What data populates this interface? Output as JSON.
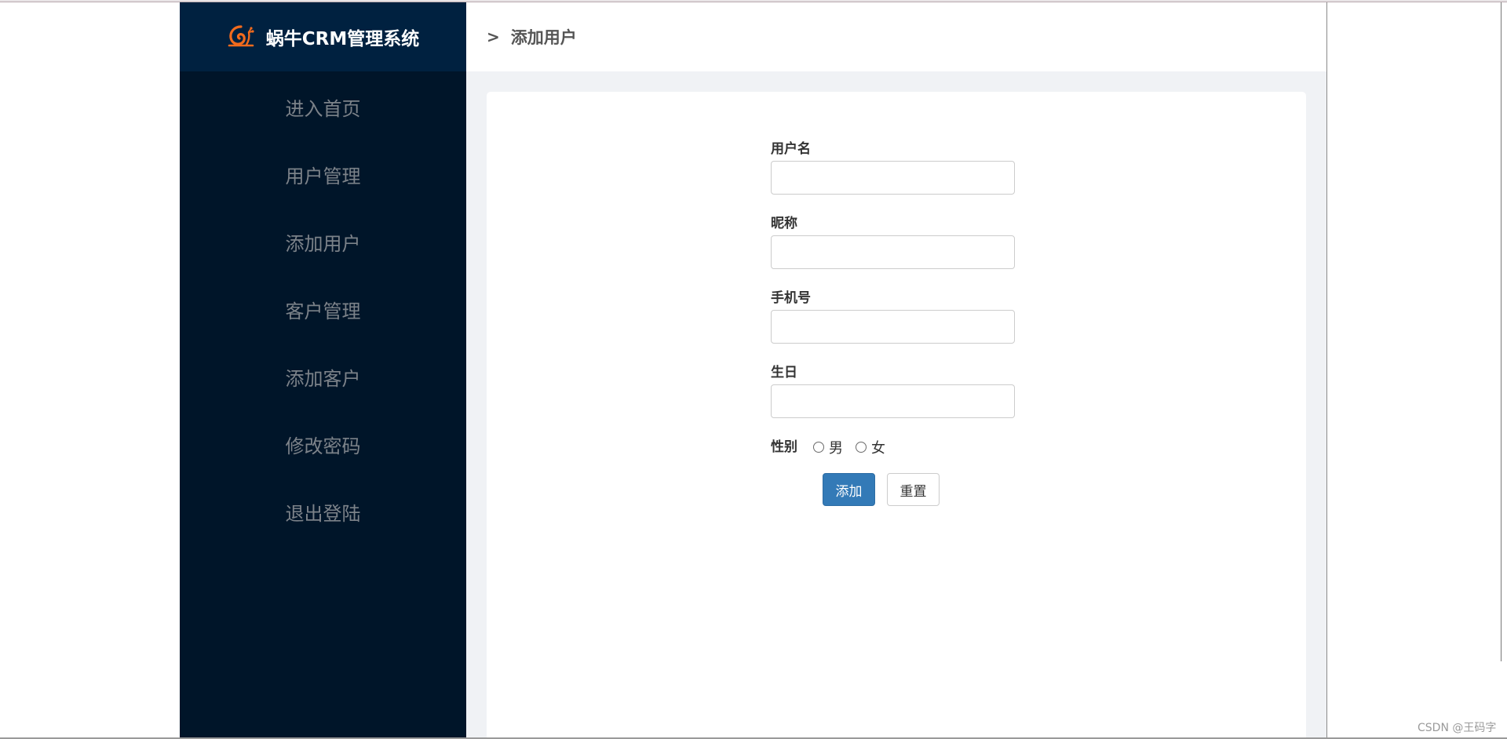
{
  "sidebar": {
    "logo_title": "蜗牛CRM管理系统",
    "logo_icon": "snail-icon",
    "items": [
      {
        "label": "进入首页"
      },
      {
        "label": "用户管理"
      },
      {
        "label": "添加用户"
      },
      {
        "label": "客户管理"
      },
      {
        "label": "添加客户"
      },
      {
        "label": "修改密码"
      },
      {
        "label": "退出登陆"
      }
    ]
  },
  "header": {
    "separator": ">",
    "title": "添加用户"
  },
  "form": {
    "username_label": "用户名",
    "username_value": "",
    "nickname_label": "昵称",
    "nickname_value": "",
    "phone_label": "手机号",
    "phone_value": "",
    "birthday_label": "生日",
    "birthday_value": "",
    "gender_label": "性别",
    "gender_male": "男",
    "gender_female": "女",
    "submit_label": "添加",
    "reset_label": "重置"
  },
  "watermark": "CSDN @王码字",
  "colors": {
    "sidebar_bg": "#001529",
    "logo_bg": "#002140",
    "primary_button": "#337ab7",
    "content_bg": "#f0f2f5",
    "logo_accent": "#f26b1d"
  }
}
